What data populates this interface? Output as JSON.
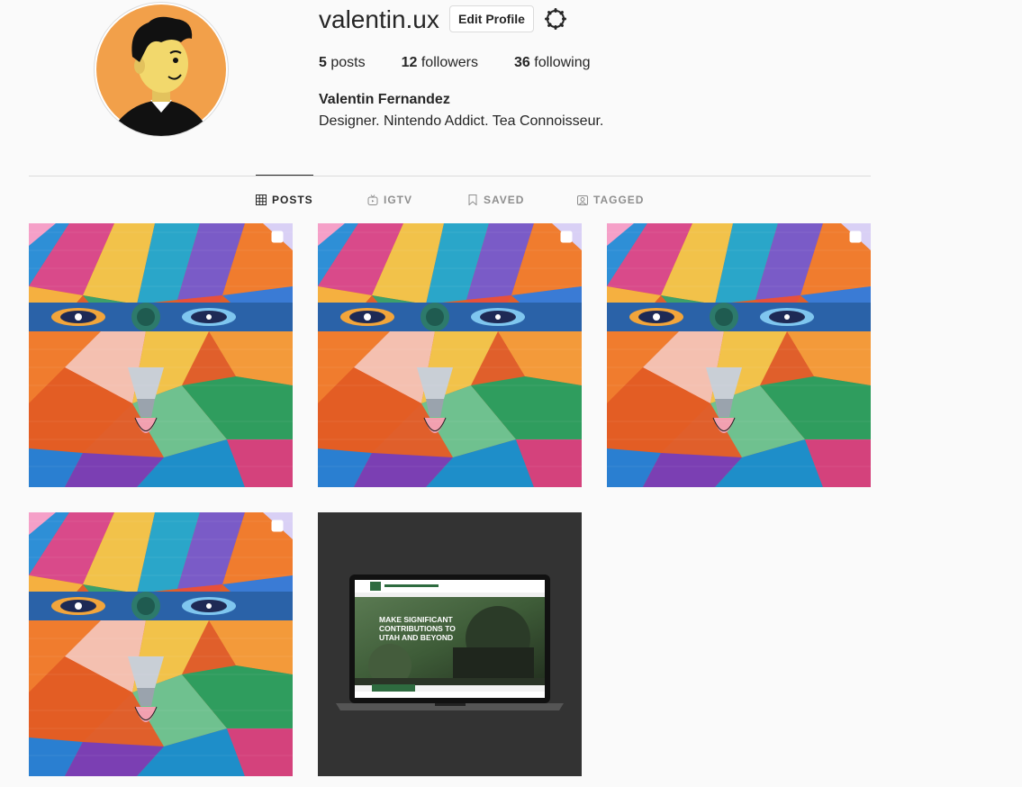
{
  "profile": {
    "username": "valentin.ux",
    "edit_label": "Edit Profile",
    "stats": [
      {
        "count": "5",
        "label": "posts"
      },
      {
        "count": "12",
        "label": "followers"
      },
      {
        "count": "36",
        "label": "following"
      }
    ],
    "full_name": "Valentin Fernandez",
    "bio": "Designer. Nintendo Addict. Tea Connoisseur."
  },
  "tabs": [
    {
      "label": "POSTS",
      "icon": "grid-icon",
      "active": true
    },
    {
      "label": "IGTV",
      "icon": "igtv-icon",
      "active": false
    },
    {
      "label": "SAVED",
      "icon": "bookmark-icon",
      "active": false
    },
    {
      "label": "TAGGED",
      "icon": "tagged-icon",
      "active": false
    }
  ],
  "laptop_post": {
    "headline_1": "MAKE SIGNIFICANT",
    "headline_2": "CONTRIBUTIONS TO",
    "headline_3": "UTAH AND BEYOND"
  },
  "colors": {
    "accent_green": "#2e6b3f",
    "border": "#dbdbdb",
    "text": "#262626",
    "muted": "#8e8e8e"
  }
}
